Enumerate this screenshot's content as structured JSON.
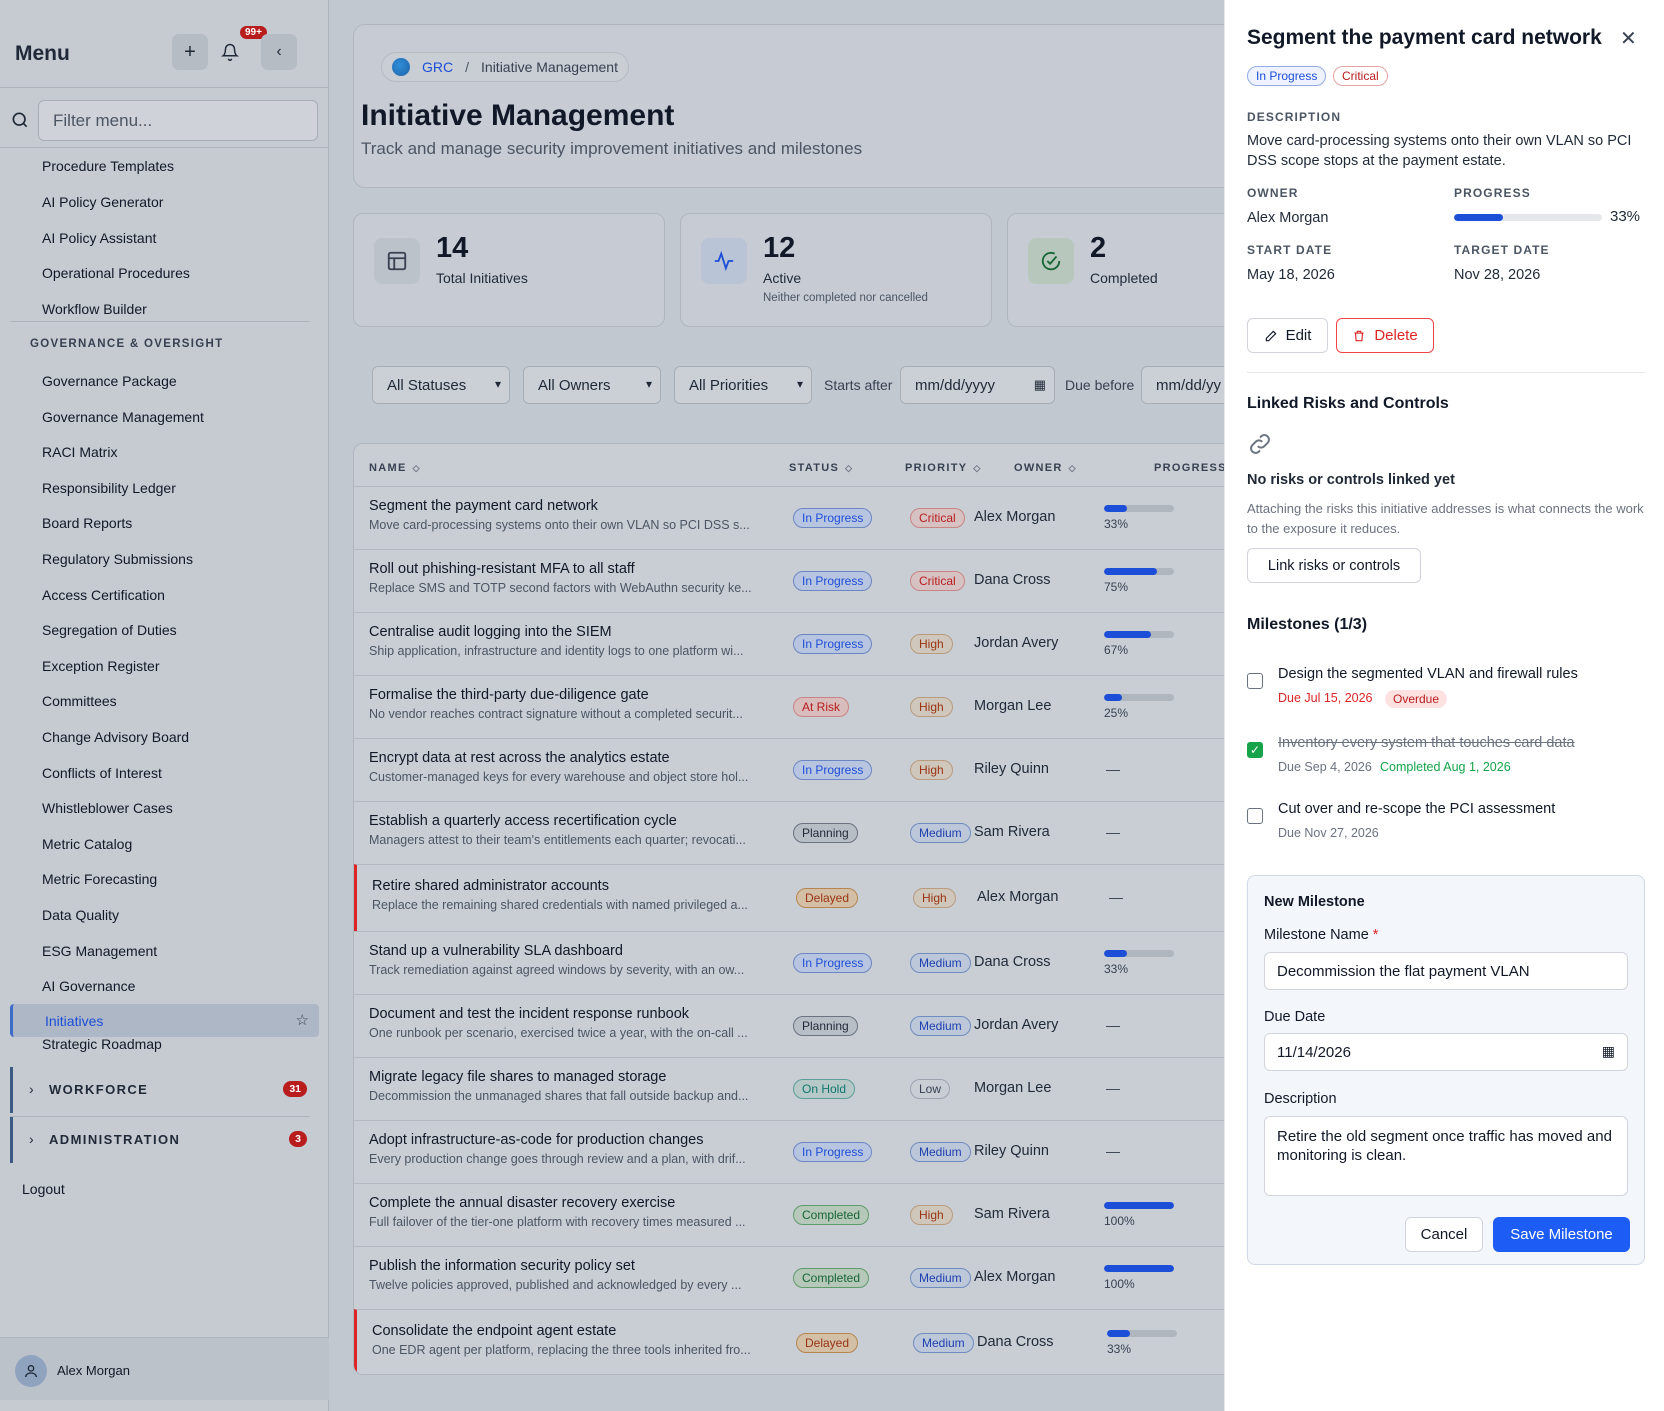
{
  "sidebar": {
    "title": "Menu",
    "notif_badge": "99+",
    "filter_placeholder": "Filter menu...",
    "items_top": [
      "Procedure Templates",
      "AI Policy Generator",
      "AI Policy Assistant",
      "Operational Procedures",
      "Workflow Builder"
    ],
    "group_label": "GOVERNANCE & OVERSIGHT",
    "items_gov": [
      "Governance Package",
      "Governance Management",
      "RACI Matrix",
      "Responsibility Ledger",
      "Board Reports",
      "Regulatory Submissions",
      "Access Certification",
      "Segregation of Duties",
      "Exception Register",
      "Committees",
      "Change Advisory Board",
      "Conflicts of Interest",
      "Whistleblower Cases",
      "Metric Catalog",
      "Metric Forecasting",
      "Data Quality",
      "ESG Management",
      "AI Governance"
    ],
    "active_item": "Initiatives",
    "after_active": "Strategic Roadmap",
    "sections": [
      {
        "label": "WORKFORCE",
        "count": "31"
      },
      {
        "label": "ADMINISTRATION",
        "count": "3"
      }
    ],
    "logout": "Logout",
    "user": "Alex Morgan"
  },
  "breadcrumb": {
    "root": "GRC",
    "sep": "/",
    "current": "Initiative Management"
  },
  "page": {
    "title": "Initiative Management",
    "subtitle": "Track and manage security improvement initiatives and milestones"
  },
  "stats": [
    {
      "value": "14",
      "label": "Total Initiatives",
      "note": ""
    },
    {
      "value": "12",
      "label": "Active",
      "note": "Neither completed nor cancelled"
    },
    {
      "value": "2",
      "label": "Completed",
      "note": ""
    }
  ],
  "filters": {
    "status": "All Statuses",
    "owner": "All Owners",
    "priority": "All Priorities",
    "starts_after_label": "Starts after",
    "starts_after_placeholder": "mm/dd/yyyy",
    "due_before_label": "Due before",
    "due_before_placeholder": "mm/dd/yy"
  },
  "table": {
    "headers": [
      "NAME",
      "STATUS",
      "PRIORITY",
      "OWNER",
      "PROGRESS"
    ],
    "rows": [
      {
        "name": "Segment the payment card network",
        "desc": "Move card-processing systems onto their own VLAN so PCI DSS s...",
        "status": "In Progress",
        "priority": "Critical",
        "owner": "Alex Morgan",
        "progress": 33,
        "pct": "33%",
        "flag": false
      },
      {
        "name": "Roll out phishing-resistant MFA to all staff",
        "desc": "Replace SMS and TOTP second factors with WebAuthn security ke...",
        "status": "In Progress",
        "priority": "Critical",
        "owner": "Dana Cross",
        "progress": 75,
        "pct": "75%",
        "flag": false
      },
      {
        "name": "Centralise audit logging into the SIEM",
        "desc": "Ship application, infrastructure and identity logs to one platform wi...",
        "status": "In Progress",
        "priority": "High",
        "owner": "Jordan Avery",
        "progress": 67,
        "pct": "67%",
        "flag": false
      },
      {
        "name": "Formalise the third-party due-diligence gate",
        "desc": "No vendor reaches contract signature without a completed securit...",
        "status": "At Risk",
        "priority": "High",
        "owner": "Morgan Lee",
        "progress": 25,
        "pct": "25%",
        "flag": false
      },
      {
        "name": "Encrypt data at rest across the analytics estate",
        "desc": "Customer-managed keys for every warehouse and object store hol...",
        "status": "In Progress",
        "priority": "High",
        "owner": "Riley Quinn",
        "progress": null,
        "pct": "—",
        "flag": false
      },
      {
        "name": "Establish a quarterly access recertification cycle",
        "desc": "Managers attest to their team's entitlements each quarter; revocati...",
        "status": "Planning",
        "priority": "Medium",
        "owner": "Sam Rivera",
        "progress": null,
        "pct": "—",
        "flag": false
      },
      {
        "name": "Retire shared administrator accounts",
        "desc": "Replace the remaining shared credentials with named privileged a...",
        "status": "Delayed",
        "priority": "High",
        "owner": "Alex Morgan",
        "progress": null,
        "pct": "—",
        "flag": true
      },
      {
        "name": "Stand up a vulnerability SLA dashboard",
        "desc": "Track remediation against agreed windows by severity, with an ow...",
        "status": "In Progress",
        "priority": "Medium",
        "owner": "Dana Cross",
        "progress": 33,
        "pct": "33%",
        "flag": false
      },
      {
        "name": "Document and test the incident response runbook",
        "desc": "One runbook per scenario, exercised twice a year, with the on-call ...",
        "status": "Planning",
        "priority": "Medium",
        "owner": "Jordan Avery",
        "progress": null,
        "pct": "—",
        "flag": false
      },
      {
        "name": "Migrate legacy file shares to managed storage",
        "desc": "Decommission the unmanaged shares that fall outside backup and...",
        "status": "On Hold",
        "priority": "Low",
        "owner": "Morgan Lee",
        "progress": null,
        "pct": "—",
        "flag": false
      },
      {
        "name": "Adopt infrastructure-as-code for production changes",
        "desc": "Every production change goes through review and a plan, with drif...",
        "status": "In Progress",
        "priority": "Medium",
        "owner": "Riley Quinn",
        "progress": null,
        "pct": "—",
        "flag": false
      },
      {
        "name": "Complete the annual disaster recovery exercise",
        "desc": "Full failover of the tier-one platform with recovery times measured ...",
        "status": "Completed",
        "priority": "High",
        "owner": "Sam Rivera",
        "progress": 100,
        "pct": "100%",
        "flag": false
      },
      {
        "name": "Publish the information security policy set",
        "desc": "Twelve policies approved, published and acknowledged by every ...",
        "status": "Completed",
        "priority": "Medium",
        "owner": "Alex Morgan",
        "progress": 100,
        "pct": "100%",
        "flag": false
      },
      {
        "name": "Consolidate the endpoint agent estate",
        "desc": "One EDR agent per platform, replacing the three tools inherited fro...",
        "status": "Delayed",
        "priority": "Medium",
        "owner": "Dana Cross",
        "progress": 33,
        "pct": "33%",
        "flag": true
      }
    ]
  },
  "panel": {
    "title": "Segment the payment card network",
    "status": "In Progress",
    "priority": "Critical",
    "description_label": "DESCRIPTION",
    "description": "Move card-processing systems onto their own VLAN so PCI DSS scope stops at the payment estate.",
    "owner_label": "OWNER",
    "owner": "Alex Morgan",
    "progress_label": "PROGRESS",
    "progress": 33,
    "progress_text": "33%",
    "start_label": "START DATE",
    "start": "May 18, 2026",
    "target_label": "TARGET DATE",
    "target": "Nov 28, 2026",
    "edit": "Edit",
    "delete": "Delete",
    "linked_title": "Linked Risks and Controls",
    "linked_empty": "No risks or controls linked yet",
    "linked_help": "Attaching the risks this initiative addresses is what connects the work to the exposure it reduces.",
    "link_button": "Link risks or controls",
    "milestones_title": "Milestones (1/3)",
    "milestones": [
      {
        "name": "Design the segmented VLAN and firewall rules",
        "due": "Due Jul 15, 2026",
        "tag": "Overdue",
        "done": false
      },
      {
        "name": "Inventory every system that touches card data",
        "due": "Due Sep 4, 2026",
        "tag": "Completed Aug 1, 2026",
        "done": true
      },
      {
        "name": "Cut over and re-scope the PCI assessment",
        "due": "Due Nov 27, 2026",
        "tag": "",
        "done": false
      }
    ],
    "form": {
      "title": "New Milestone",
      "name_label": "Milestone Name",
      "required": "*",
      "name_value": "Decommission the flat payment VLAN",
      "due_label": "Due Date",
      "due_value": "11/14/2026",
      "desc_label": "Description",
      "desc_value": "Retire the old segment once traffic has moved and monitoring is clean.",
      "cancel": "Cancel",
      "save": "Save Milestone"
    }
  },
  "colors": {
    "accent": "#1d4ed8",
    "danger": "#dc2626",
    "success": "#16a34a"
  }
}
